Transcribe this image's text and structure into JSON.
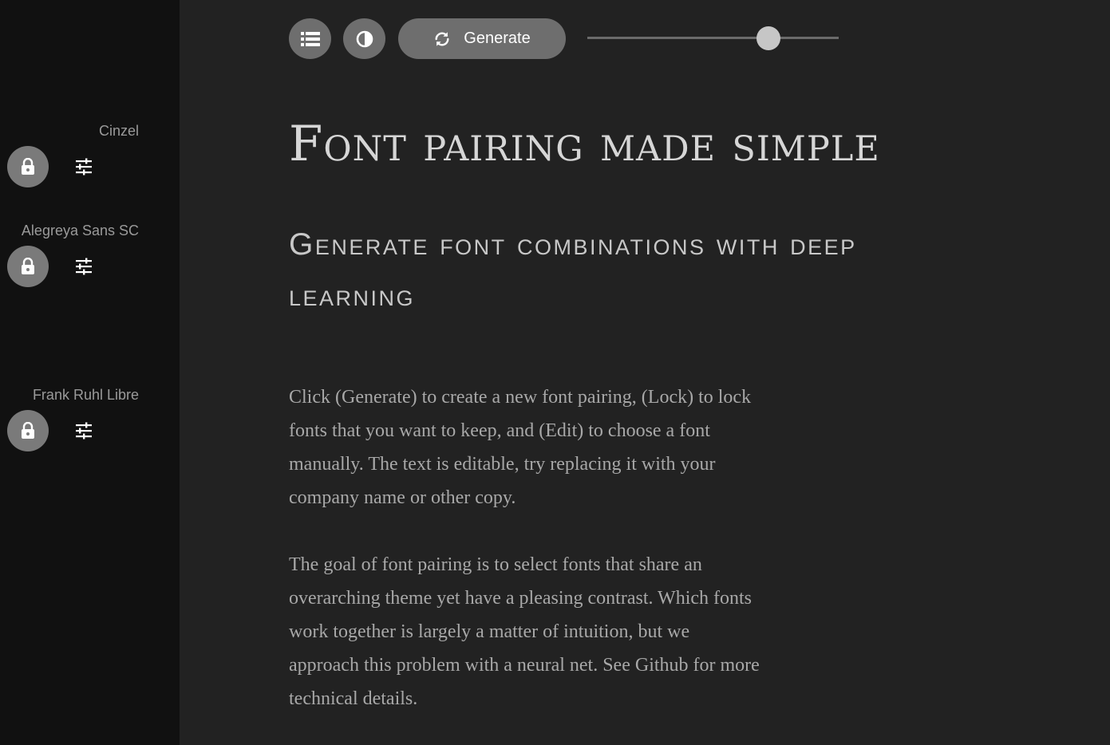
{
  "sidebar": {
    "fonts": [
      {
        "name": "Cinzel",
        "lock_icon": "lock-icon",
        "edit_icon": "tune-icon"
      },
      {
        "name": "Alegreya Sans SC",
        "lock_icon": "lock-icon",
        "edit_icon": "tune-icon"
      },
      {
        "name": "Frank Ruhl Libre",
        "lock_icon": "lock-icon",
        "edit_icon": "tune-icon"
      }
    ]
  },
  "toolbar": {
    "list_icon": "list-icon",
    "contrast_icon": "contrast-icon",
    "generate_icon": "refresh-icon",
    "generate_label": "Generate",
    "slider_value": 0.72
  },
  "content": {
    "title": "Font pairing made simple",
    "subtitle": "Generate font combinations with deep learning",
    "paragraph1": "Click (Generate) to create a new font pairing, (Lock) to lock fonts that you want to keep, and (Edit) to choose a font manually. The text is editable, try replacing it with your company name or other copy.",
    "paragraph2": "The goal of font pairing is to select fonts that share an overarching theme yet have a pleasing contrast. Which fonts work together is largely a matter of intuition, but we approach this problem with a neural net. See Github for more technical details."
  },
  "colors": {
    "sidebar_bg": "#111111",
    "main_bg": "#222222",
    "button_bg": "#6e6e6e",
    "lock_bg": "#7a7a7a",
    "slider_thumb": "#c6c6c6"
  }
}
